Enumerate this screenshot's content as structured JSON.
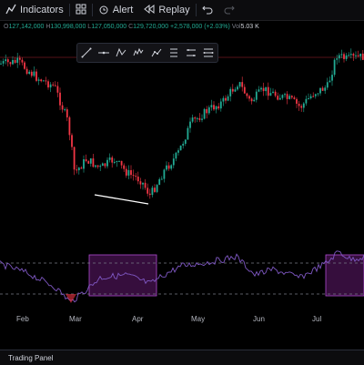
{
  "toolbar": {
    "indicators_label": "Indicators",
    "alert_label": "Alert",
    "replay_label": "Replay"
  },
  "ohlc": {
    "o_key": "O",
    "o_val": "127,142,000",
    "h_key": "H",
    "h_val": "130,998,000",
    "l_key": "L",
    "l_val": "127,050,000",
    "c_key": "C",
    "c_val": "129,720,000",
    "change": "+2,578,000 (+2.03%)",
    "vol_key": "Vol",
    "vol_val": "5.03 K"
  },
  "xaxis": {
    "labels": [
      "Feb",
      "Mar",
      "Apr",
      "May",
      "Jun",
      "Jul"
    ]
  },
  "bottom_panel": {
    "title": "Trading Panel"
  },
  "colors": {
    "background": "#000000",
    "up": "#22ab94",
    "down": "#f23645",
    "rsi_line": "#7e57c2",
    "highlight": "#9c27b0",
    "trendline": "#ffffff"
  }
}
